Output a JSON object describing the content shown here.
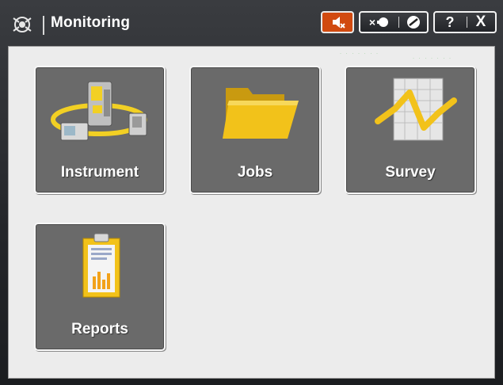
{
  "window": {
    "title": "Monitoring"
  },
  "titlebar": {
    "buttons": {
      "sound": {
        "icon": "sound-muted-icon"
      },
      "light": {
        "label": "×"
      },
      "help": {
        "label": "?"
      },
      "close": {
        "label": "X"
      }
    }
  },
  "tiles": [
    {
      "label": "Instrument",
      "icon": "total-station-icon"
    },
    {
      "label": "Jobs",
      "icon": "folder-icon"
    },
    {
      "label": "Survey",
      "icon": "survey-graph-icon"
    },
    {
      "label": "Reports",
      "icon": "report-clipboard-icon"
    }
  ],
  "colors": {
    "accent_orange": "#d14a10",
    "tile_bg": "#6a6a6a",
    "content_bg": "#ececec",
    "folder_yellow": "#f2c21a"
  }
}
